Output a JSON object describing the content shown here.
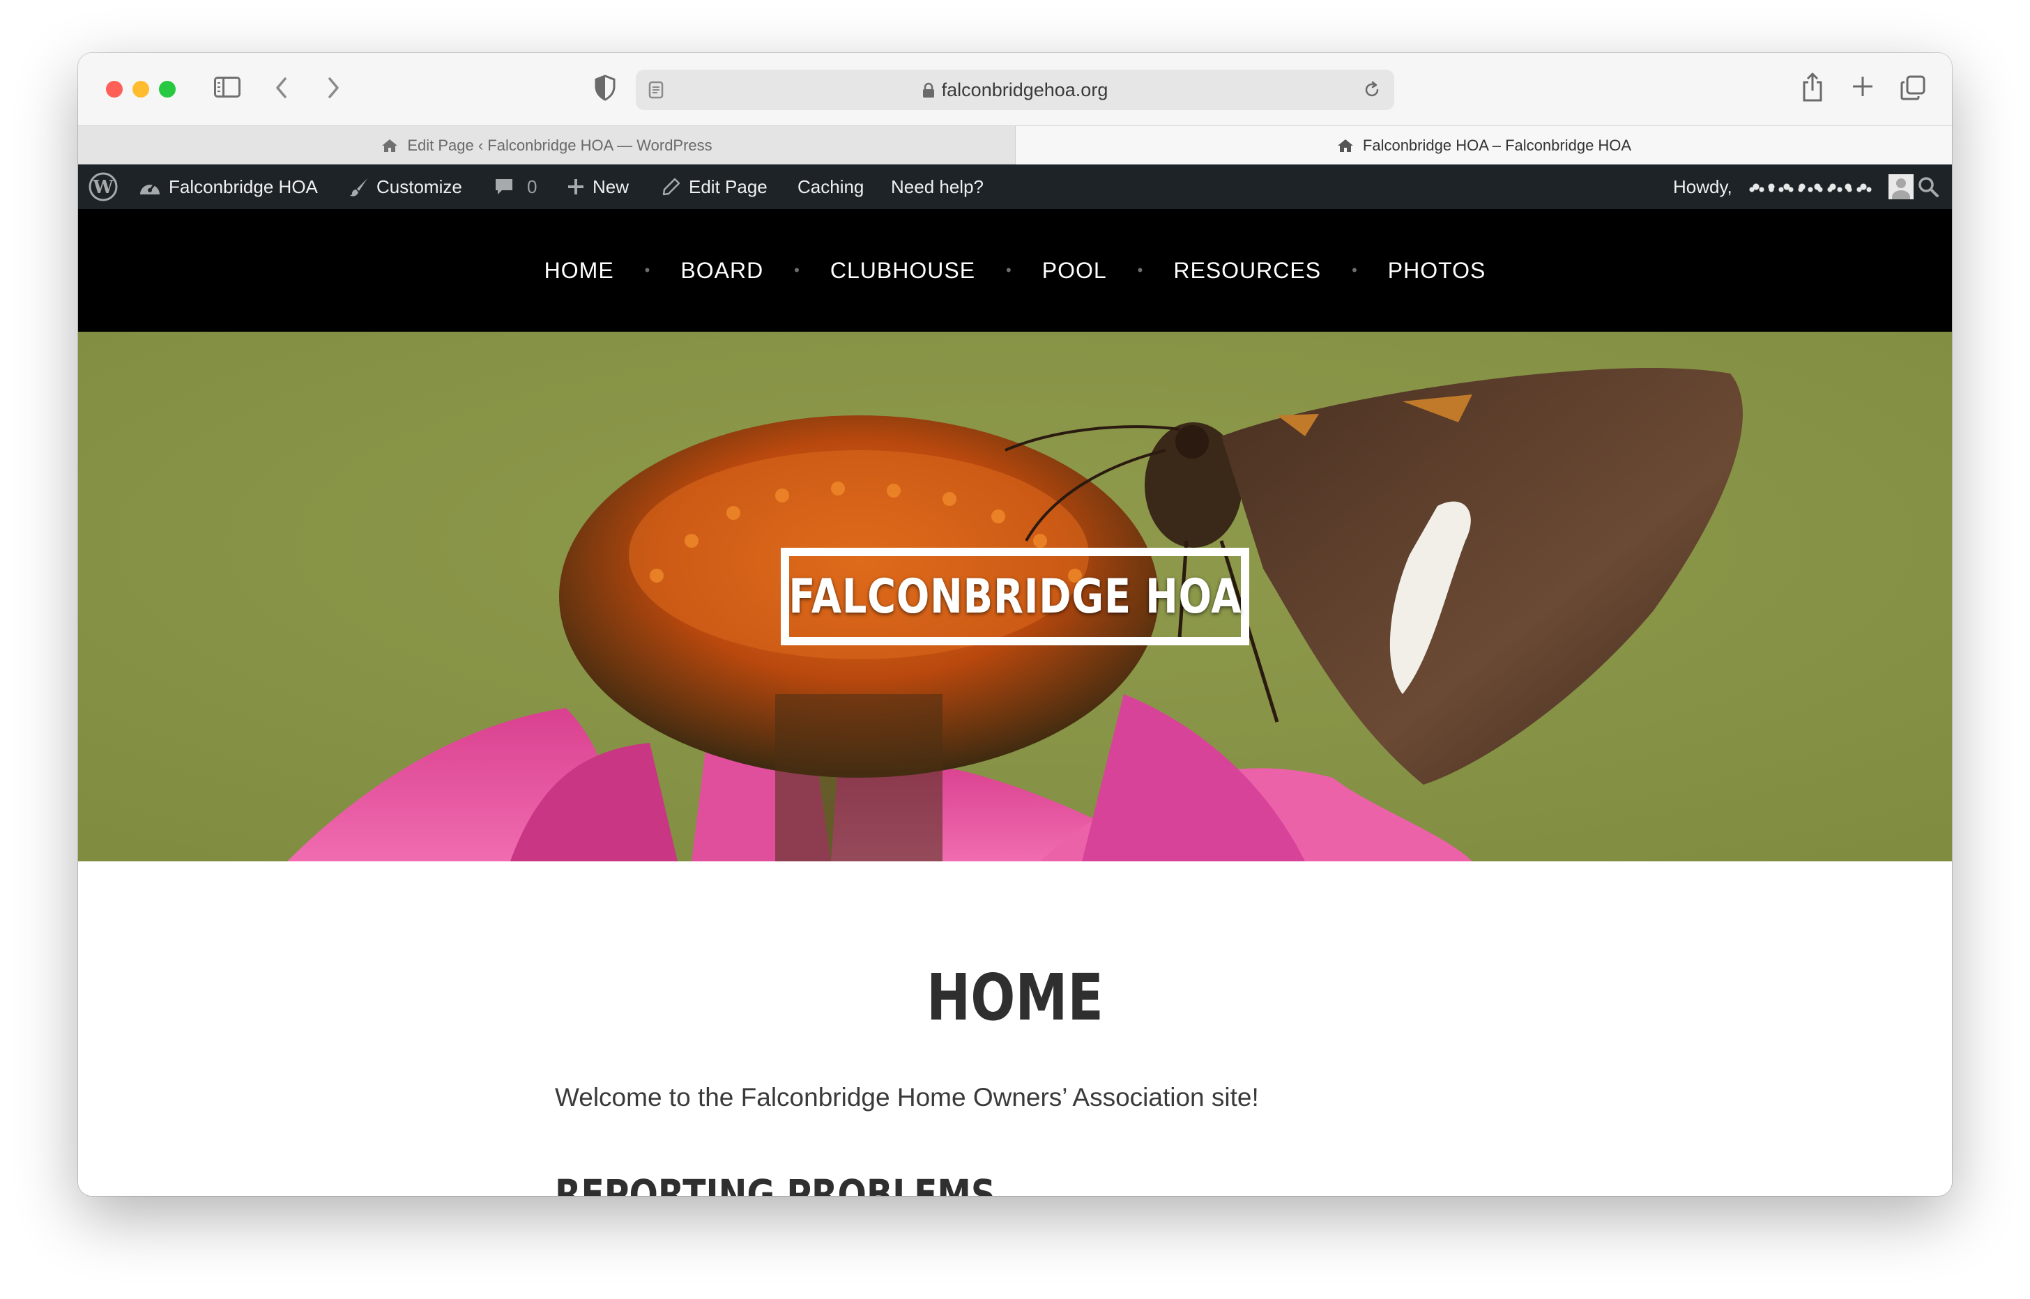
{
  "browser": {
    "url": "falconbridgehoa.org",
    "tabs": [
      {
        "title": "Edit Page ‹ Falconbridge HOA — WordPress",
        "active": false
      },
      {
        "title": "Falconbridge HOA – Falconbridge HOA",
        "active": true
      }
    ]
  },
  "adminbar": {
    "site_name": "Falconbridge HOA",
    "customize": "Customize",
    "comments_count": "0",
    "new_label": "New",
    "edit_page": "Edit Page",
    "caching": "Caching",
    "need_help": "Need help?",
    "howdy": "Howdy,"
  },
  "nav": {
    "items": [
      "HOME",
      "BOARD",
      "CLUBHOUSE",
      "POOL",
      "RESOURCES",
      "PHOTOS"
    ]
  },
  "hero": {
    "site_title": "FALCONBRIDGE HOA",
    "background_color": "#8a9647"
  },
  "page": {
    "title": "HOME",
    "intro": "Welcome to the Falconbridge Home Owners’ Association site!",
    "subheading": "REPORTING PROBLEMS"
  },
  "colors": {
    "admin_bar": "#1d2327",
    "nav_bar": "#000000",
    "heading_text": "#2f2f2f"
  }
}
